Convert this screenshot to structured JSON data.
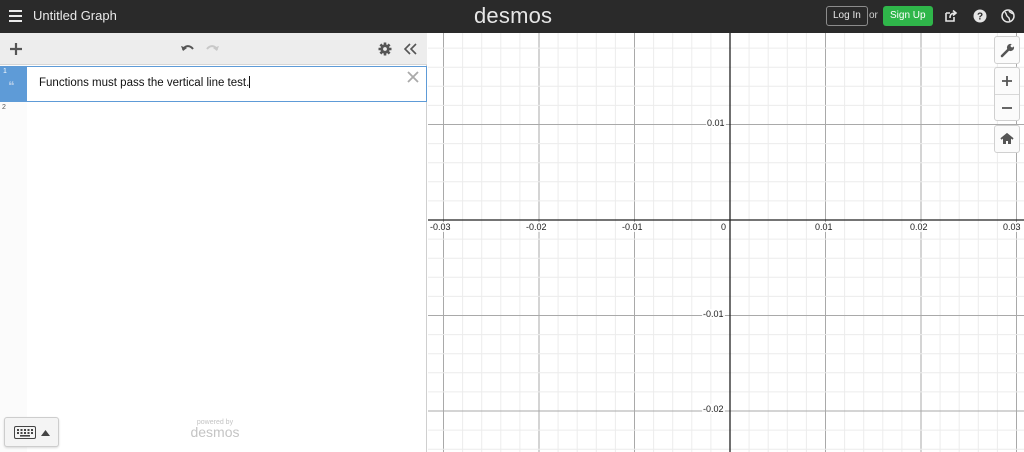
{
  "header": {
    "title": "Untitled Graph",
    "logo": "desmos",
    "login_label": "Log In",
    "or_label": "or",
    "signup_label": "Sign Up"
  },
  "toolbar": {
    "icons": [
      "add-icon",
      "undo-icon",
      "redo-icon",
      "gear-icon",
      "collapse-icon"
    ]
  },
  "expressions": [
    {
      "index": "1",
      "type": "note",
      "text": "Functions must pass the vertical line test."
    },
    {
      "index": "2",
      "text": ""
    }
  ],
  "footer": {
    "powered_label": "powered by",
    "powered_logo": "desmos"
  },
  "graph": {
    "x_ticks": [
      "-0.03",
      "-0.02",
      "-0.01",
      "0",
      "0.01",
      "0.02",
      "0.03"
    ],
    "y_ticks": [
      "0.01",
      "-0.01",
      "-0.02"
    ],
    "tools": [
      "wrench-icon",
      "zoom-in-icon",
      "zoom-out-icon",
      "home-icon"
    ]
  },
  "colors": {
    "header_bg": "#2a2a2a",
    "accent_blue": "#5e9bd7",
    "signup_green": "#2fb64a"
  }
}
